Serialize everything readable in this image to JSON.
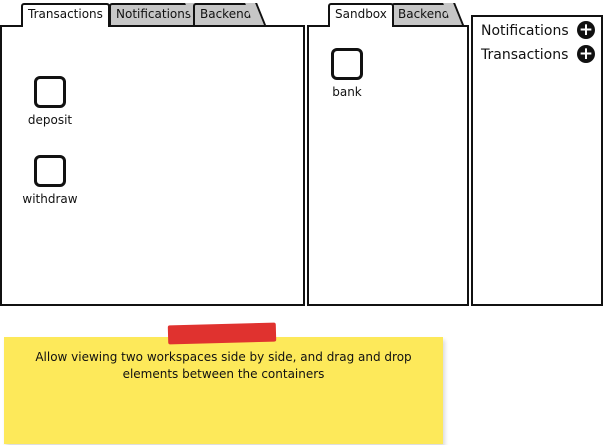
{
  "left_workspace": {
    "tabs": [
      {
        "label": "Transactions",
        "active": true
      },
      {
        "label": "Notifications",
        "active": false
      },
      {
        "label": "Backend",
        "active": false
      }
    ],
    "items": [
      {
        "label": "deposit",
        "icon": "square-block-icon"
      },
      {
        "label": "withdraw",
        "icon": "square-block-icon"
      }
    ]
  },
  "middle_workspace": {
    "tabs": [
      {
        "label": "Sandbox",
        "active": true
      },
      {
        "label": "Backend",
        "active": false
      }
    ],
    "items": [
      {
        "label": "bank",
        "icon": "square-block-icon"
      }
    ]
  },
  "workspace_list": {
    "items": [
      {
        "label": "Notifications",
        "icon": "plus-circle-icon"
      },
      {
        "label": "Transactions",
        "icon": "plus-circle-icon"
      }
    ]
  },
  "sticky_note": {
    "text": "Allow viewing two workspaces side by side, and drag and drop elements between the containers",
    "color": "#fde95a",
    "tape_color": "#e0322f"
  },
  "colors": {
    "inactive_tab": "#c6c6c6",
    "stroke": "#111111"
  }
}
